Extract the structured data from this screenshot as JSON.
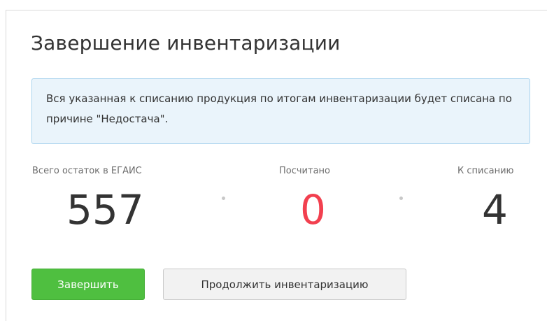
{
  "dialog": {
    "title": "Завершение инвентаризации",
    "notice": "Вся указанная к списанию продукция по итогам инвентаризации будет списана по причине \"Недостача\"."
  },
  "stats": [
    {
      "label": "Всего остаток в ЕГАИС",
      "value": "557",
      "color": "#333333"
    },
    {
      "label": "Посчитано",
      "value": "0",
      "color": "#f2404f"
    },
    {
      "label": "К списанию",
      "value": "4",
      "color": "#333333"
    }
  ],
  "buttons": {
    "finish_label": "Завершить",
    "continue_label": "Продолжить инвентаризацию"
  },
  "colors": {
    "finish_button": "#4fbf40",
    "notice_background": "#eaf4fb",
    "notice_border": "#a9d3ee",
    "counted_value": "#f2404f"
  }
}
